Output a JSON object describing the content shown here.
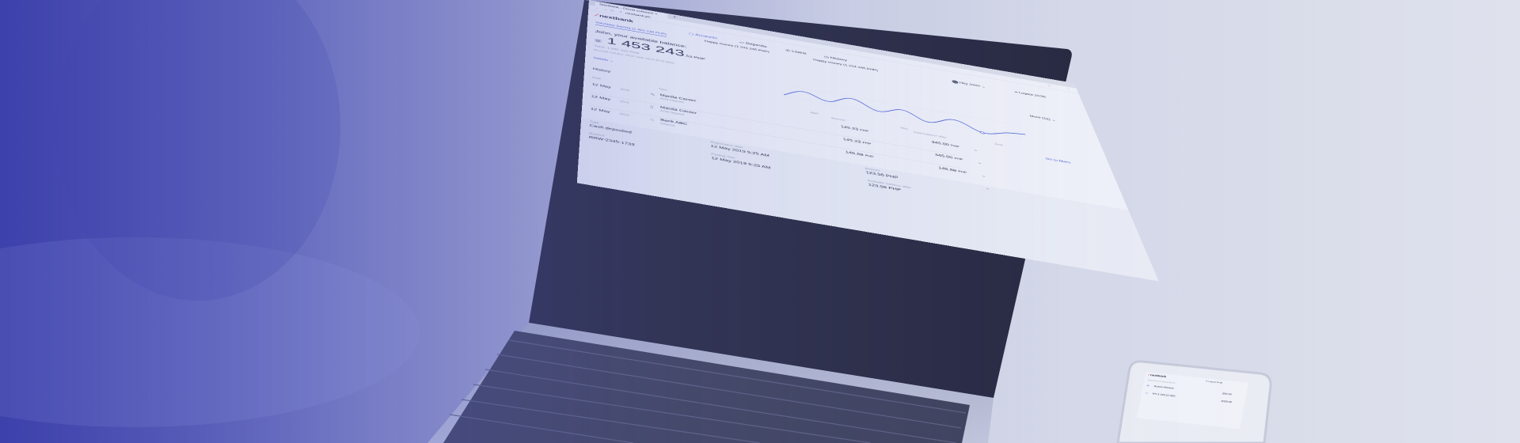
{
  "browser": {
    "tab_title": "Nextbank - Cloud software ×",
    "new_tab": "+",
    "url": "nextbank.ph"
  },
  "app": {
    "logo_text": "nextbank",
    "nav": [
      {
        "label": "Accounts",
        "icon": "wallet-icon"
      },
      {
        "label": "Deposits",
        "icon": "card-icon"
      },
      {
        "label": "Loans",
        "icon": "coins-icon"
      },
      {
        "label": "History",
        "icon": "clock-icon"
      }
    ],
    "account_tabs": [
      {
        "label": "Voluntary Saving (1 453 234 PHP)"
      },
      {
        "label": "Happy money (1 234 345 PHP)"
      },
      {
        "label": "Happy money (1 234 345 PHP)"
      }
    ],
    "user": {
      "greeting": "Hey John!",
      "logout": "Logout",
      "timer": "10:00"
    },
    "balance": {
      "heading": "John, your available balance:",
      "amount_main": "1 453 243",
      "amount_fraction": ".53 PHP",
      "total": "Total: 1 550 320 PHP",
      "account_number": "Account number: 2610 3445 4474 9273 9925",
      "details_link": "Details"
    },
    "chart": {
      "period_select": "More (12)",
      "x_labels": [
        "April",
        "May",
        "June"
      ]
    },
    "history": {
      "title": "History",
      "date_header": "Date",
      "type_header": "Type",
      "amount_header": "Amount",
      "balance_header": "Total balance after",
      "go_to_filters": "Go to filters",
      "rows": [
        {
          "date": "12 May",
          "year": "2019",
          "title": "Manila Center",
          "sub": "ATM Deposit",
          "amount": "145.23",
          "unit": "PHP",
          "balance": "345.00",
          "balance_unit": "PHP"
        },
        {
          "date": "12 May",
          "year": "2019",
          "title": "Manila Center",
          "sub": "ATM Deposit",
          "amount": "145.23",
          "unit": "PHP",
          "balance": "345.00",
          "balance_unit": "PHP"
        },
        {
          "date": "12 May",
          "year": "2019",
          "title": "Bank ABC",
          "sub": "Deposit",
          "amount": "145.88",
          "unit": "PHP",
          "balance": "145.88",
          "balance_unit": "PHP"
        }
      ],
      "detail": {
        "type_label": "Type",
        "type_value": "Cash deposited",
        "number_label": "Number",
        "number_value": "RRW-2345-1733",
        "registration_label": "Registration date",
        "registration_value": "12 May 2019 5:25 AM",
        "posting_label": "Posting date",
        "posting_value": "12 May 2019 5:25 AM",
        "amount_label": "Amount",
        "amount_value": "123.56 PHP",
        "avail_label": "Available balance after",
        "avail_value": "123.56 PHP"
      }
    }
  },
  "phone": {
    "logo_text": "nextbank",
    "logout": "Logout",
    "timer": "10:00",
    "section": "Most Recent transactions",
    "rows": [
      {
        "title": "Ruben Almarlo",
        "amount": "600.00"
      },
      {
        "title": "PH 3 345,21 855",
        "amount": "1000.00"
      }
    ]
  },
  "colors": {
    "accent": "#4d62d8",
    "logo_red": "#e8334a",
    "overlay_start": "#3e42b4",
    "background": "#dfe2ec"
  }
}
